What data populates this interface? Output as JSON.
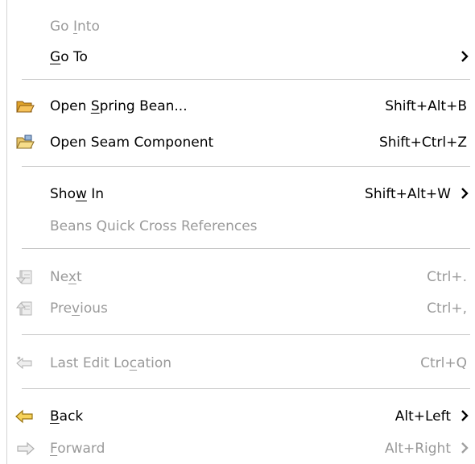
{
  "menu": {
    "go_into": {
      "pre": "Go ",
      "mn": "I",
      "post": "nto"
    },
    "go_to": {
      "pre": "",
      "mn": "G",
      "post": "o To"
    },
    "open_spring_bean": {
      "pre": "Open ",
      "mn": "S",
      "post": "pring Bean...",
      "shortcut": "Shift+Alt+B",
      "icon": "folder-open-icon"
    },
    "open_seam_component": {
      "pre": "Open Seam Component",
      "mn": "",
      "post": "",
      "shortcut": "Shift+Ctrl+Z",
      "icon": "folder-open-component-icon"
    },
    "show_in": {
      "pre": "Sho",
      "mn": "w",
      "post": " In",
      "shortcut": "Shift+Alt+W"
    },
    "beans_quick_cross_references": {
      "label": "Beans Quick Cross References"
    },
    "next": {
      "pre": "Ne",
      "mn": "x",
      "post": "t",
      "shortcut": "Ctrl+.",
      "icon": "next-annotation-icon"
    },
    "previous": {
      "pre": "Pre",
      "mn": "v",
      "post": "ious",
      "shortcut": "Ctrl+,",
      "icon": "previous-annotation-icon"
    },
    "last_edit_location": {
      "pre": "Last Edit Lo",
      "mn": "c",
      "post": "ation",
      "shortcut": "Ctrl+Q",
      "icon": "last-edit-location-icon"
    },
    "back": {
      "pre": "",
      "mn": "B",
      "post": "ack",
      "shortcut": "Alt+Left",
      "icon": "back-arrow-icon"
    },
    "forward": {
      "pre": "",
      "mn": "F",
      "post": "orward",
      "shortcut": "Alt+Right",
      "icon": "forward-arrow-icon"
    }
  },
  "colors": {
    "enabled_text": "#000000",
    "disabled_text": "#9a9a9a",
    "separator": "#c7c7c7",
    "icon_yellow": "#f2c33a"
  }
}
